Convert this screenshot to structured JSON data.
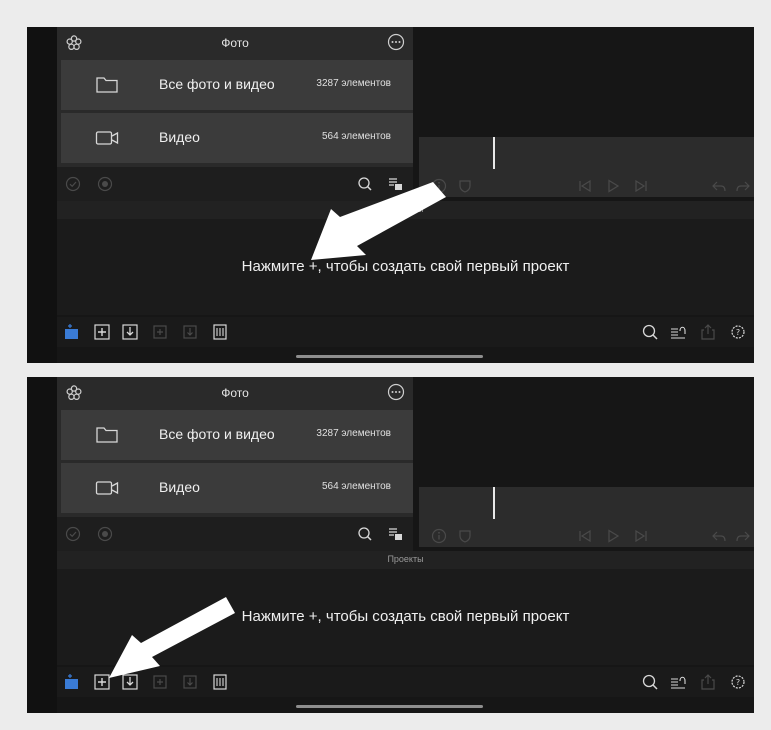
{
  "screens": [
    {
      "photo_panel": {
        "title": "Фото",
        "albums": [
          {
            "icon": "folder-icon",
            "name": "Все фото и видео",
            "count": "3287 элементов"
          },
          {
            "icon": "video-camera-icon",
            "name": "Видео",
            "count": "564 элементов"
          }
        ]
      },
      "projects_label": "Проекты",
      "empty_hint": "Нажмите +, чтобы создать свой первый проект",
      "arrow_target": "project-area"
    },
    {
      "photo_panel": {
        "title": "Фото",
        "albums": [
          {
            "icon": "folder-icon",
            "name": "Все фото и видео",
            "count": "3287 элементов"
          },
          {
            "icon": "video-camera-icon",
            "name": "Видео",
            "count": "564 элементов"
          }
        ]
      },
      "projects_label": "Проекты",
      "empty_hint": "Нажмите +, чтобы создать свой первый проект",
      "arrow_target": "add-project-button"
    }
  ],
  "colors": {
    "page_background": "#ececec",
    "screen_background": "#161616",
    "accent_blue": "#3a7bd5",
    "arrow": "#ffffff"
  }
}
